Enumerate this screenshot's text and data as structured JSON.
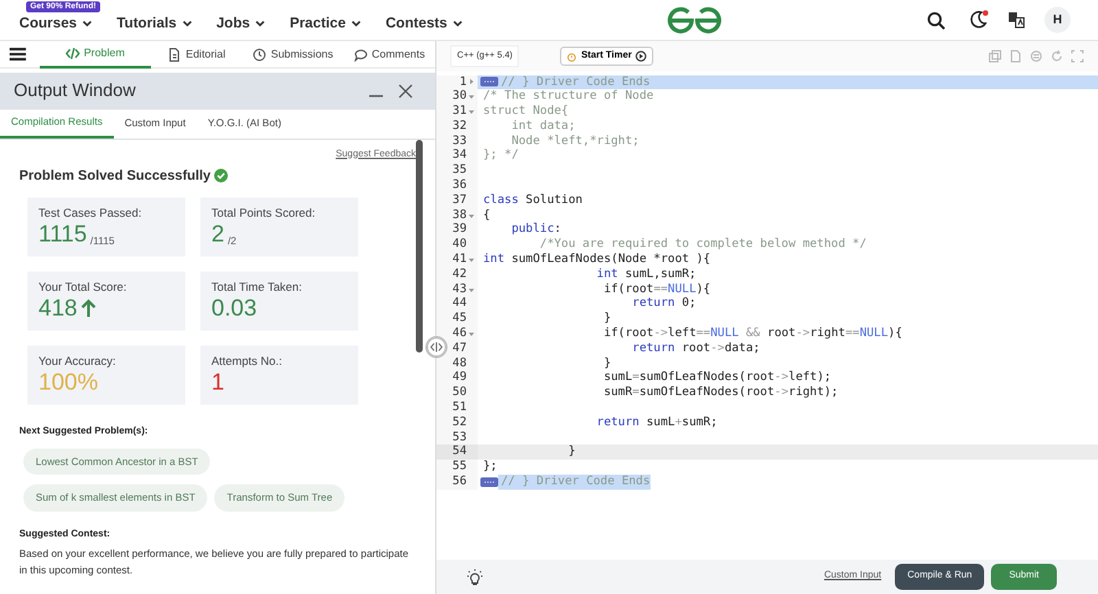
{
  "nav": {
    "promo_badge": "Get 90% Refund!",
    "menu": [
      "Courses",
      "Tutorials",
      "Jobs",
      "Practice",
      "Contests"
    ],
    "theme_notification": true,
    "avatar": "H"
  },
  "problem_tabs": [
    {
      "label": "Problem",
      "selected": true
    },
    {
      "label": "Editorial",
      "selected": false
    },
    {
      "label": "Submissions",
      "selected": false
    },
    {
      "label": "Comments",
      "selected": false
    }
  ],
  "output_window": {
    "title": "Output Window",
    "tabs": [
      {
        "label": "Compilation Results",
        "selected": true
      },
      {
        "label": "Custom Input",
        "selected": false
      },
      {
        "label": "Y.O.G.I. (AI Bot)",
        "selected": false
      }
    ],
    "feedback_link": "Suggest Feedback",
    "status": "Problem Solved Successfully",
    "stats": [
      {
        "label": "Test Cases Passed:",
        "value": "1115",
        "total": "/1115",
        "color": "#3d8a4e",
        "arrow": false
      },
      {
        "label": "Total Points Scored:",
        "value": "2",
        "total": "/2",
        "color": "#3d8a4e",
        "arrow": false
      },
      {
        "label": "Your Total Score:",
        "value": "418",
        "color": "#3d8a4e",
        "arrow": true
      },
      {
        "label": "Total Time Taken:",
        "value": "0.03",
        "color": "#3d8a4e",
        "arrow": false
      },
      {
        "label": "Your Accuracy:",
        "value": "100%",
        "color": "#e0b24a",
        "arrow": false
      },
      {
        "label": "Attempts No.:",
        "value": "1",
        "color": "#d9302c",
        "arrow": false
      }
    ],
    "next_heading": "Next Suggested Problem(s):",
    "suggested_problems": [
      [
        "Lowest Common Ancestor in a BST"
      ],
      [
        "Sum of k smallest elements in BST",
        "Transform to Sum Tree"
      ]
    ],
    "contest_heading": "Suggested Contest:",
    "contest_text": "Based on your excellent performance, we believe you are fully prepared to participate in this upcoming contest."
  },
  "editor": {
    "language": "C++ (g++ 5.4)",
    "timer_button": "Start Timer",
    "lines": [
      {
        "number": "1",
        "foldable": true,
        "collapsed": true,
        "folded": true,
        "active": true,
        "selected": true,
        "tokens": [
          {
            "kind": "comment",
            "text": "// } Driver Code Ends"
          }
        ]
      },
      {
        "number": "30",
        "foldable": true,
        "collapsed": false,
        "tokens": [
          {
            "kind": "comment",
            "text": "/* The structure of Node"
          }
        ]
      },
      {
        "number": "31",
        "foldable": true,
        "collapsed": false,
        "tokens": [
          {
            "kind": "comment",
            "text": "struct Node{"
          }
        ]
      },
      {
        "number": "32",
        "tokens": [
          {
            "kind": "comment",
            "text": "    int data;"
          }
        ]
      },
      {
        "number": "33",
        "tokens": [
          {
            "kind": "comment",
            "text": "    Node *left,*right;"
          }
        ]
      },
      {
        "number": "34",
        "tokens": [
          {
            "kind": "comment",
            "text": "}; */"
          }
        ]
      },
      {
        "number": "35"
      },
      {
        "number": "36"
      },
      {
        "number": "37",
        "tokens": [
          {
            "kind": "keyword",
            "text": "class"
          },
          {
            "kind": "plain",
            "text": " Solution"
          }
        ]
      },
      {
        "number": "38",
        "foldable": true,
        "collapsed": false,
        "tokens": [
          {
            "kind": "plain",
            "text": "{"
          }
        ]
      },
      {
        "number": "39",
        "tokens": [
          {
            "kind": "keyword",
            "text": "    public"
          },
          {
            "kind": "plain",
            "text": ":"
          }
        ]
      },
      {
        "number": "40",
        "tokens": [
          {
            "kind": "comment",
            "text": "        /*You are required to complete below method */"
          }
        ]
      },
      {
        "number": "41",
        "foldable": true,
        "collapsed": false,
        "tokens": [
          {
            "kind": "keyword",
            "text": "int"
          },
          {
            "kind": "plain",
            "text": " sumOfLeafNodes(Node *root ){"
          }
        ]
      },
      {
        "number": "42",
        "tokens": [
          {
            "kind": "keyword",
            "text": "                int"
          },
          {
            "kind": "plain",
            "text": " sumL,sumR;"
          }
        ]
      },
      {
        "number": "43",
        "foldable": true,
        "collapsed": false,
        "tokens": [
          {
            "kind": "plain",
            "text": "                 if(root"
          },
          {
            "kind": "operator",
            "text": "=="
          },
          {
            "kind": "constant",
            "text": "NULL"
          },
          {
            "kind": "plain",
            "text": "){"
          }
        ]
      },
      {
        "number": "44",
        "tokens": [
          {
            "kind": "keyword",
            "text": "                     return"
          },
          {
            "kind": "plain",
            "text": " 0;"
          }
        ]
      },
      {
        "number": "45",
        "tokens": [
          {
            "kind": "plain",
            "text": "                 }"
          }
        ]
      },
      {
        "number": "46",
        "foldable": true,
        "collapsed": false,
        "tokens": [
          {
            "kind": "plain",
            "text": "                 if(root"
          },
          {
            "kind": "operator",
            "text": "->"
          },
          {
            "kind": "plain",
            "text": "left"
          },
          {
            "kind": "operator",
            "text": "=="
          },
          {
            "kind": "constant",
            "text": "NULL"
          },
          {
            "kind": "operator",
            "text": " && "
          },
          {
            "kind": "plain",
            "text": "root"
          },
          {
            "kind": "operator",
            "text": "->"
          },
          {
            "kind": "plain",
            "text": "right"
          },
          {
            "kind": "operator",
            "text": "=="
          },
          {
            "kind": "constant",
            "text": "NULL"
          },
          {
            "kind": "plain",
            "text": "){"
          }
        ]
      },
      {
        "number": "47",
        "tokens": [
          {
            "kind": "keyword",
            "text": "                     return"
          },
          {
            "kind": "plain",
            "text": " root"
          },
          {
            "kind": "operator",
            "text": "->"
          },
          {
            "kind": "plain",
            "text": "data;"
          }
        ]
      },
      {
        "number": "48",
        "tokens": [
          {
            "kind": "plain",
            "text": "                 }"
          }
        ]
      },
      {
        "number": "49",
        "tokens": [
          {
            "kind": "plain",
            "text": "                 sumL"
          },
          {
            "kind": "operator",
            "text": "="
          },
          {
            "kind": "plain",
            "text": "sumOfLeafNodes(root"
          },
          {
            "kind": "operator",
            "text": "->"
          },
          {
            "kind": "plain",
            "text": "left);"
          }
        ]
      },
      {
        "number": "50",
        "tokens": [
          {
            "kind": "plain",
            "text": "                 sumR"
          },
          {
            "kind": "operator",
            "text": "="
          },
          {
            "kind": "plain",
            "text": "sumOfLeafNodes(root"
          },
          {
            "kind": "operator",
            "text": "->"
          },
          {
            "kind": "plain",
            "text": "right);"
          }
        ]
      },
      {
        "number": "51"
      },
      {
        "number": "52",
        "tokens": [
          {
            "kind": "keyword",
            "text": "                return"
          },
          {
            "kind": "plain",
            "text": " sumL"
          },
          {
            "kind": "operator",
            "text": "+"
          },
          {
            "kind": "plain",
            "text": "sumR;"
          }
        ]
      },
      {
        "number": "53"
      },
      {
        "number": "54",
        "active": true,
        "tokens": [
          {
            "kind": "plain",
            "text": "            }"
          }
        ]
      },
      {
        "number": "55",
        "tokens": [
          {
            "kind": "plain",
            "text": "};"
          }
        ]
      },
      {
        "number": "56",
        "folded": true,
        "selected": true,
        "tokens": [
          {
            "kind": "comment",
            "text": "// } Driver Code Ends"
          }
        ]
      }
    ],
    "footer": {
      "custom_input_link": "Custom Input",
      "run_button": "Compile & Run",
      "submit_button": "Submit"
    }
  }
}
